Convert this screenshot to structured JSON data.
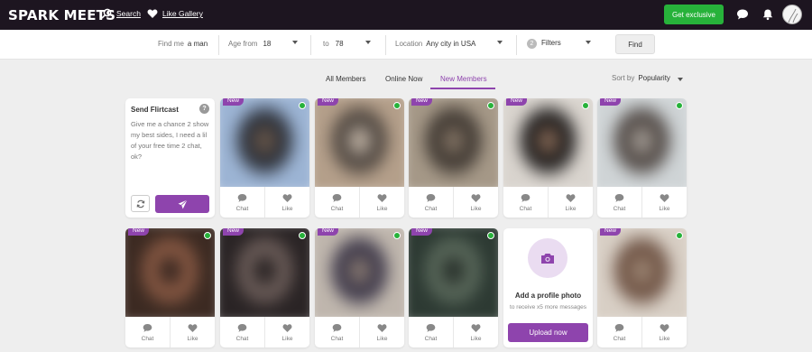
{
  "header": {
    "logo_text": "SPARK MEETS",
    "search_label": "Search",
    "like_gallery_label": "Like Gallery",
    "get_exclusive_label": "Get exclusive"
  },
  "filters": {
    "find_me_label": "Find me",
    "find_me_value": "a man",
    "age_from_label": "Age from",
    "age_from_value": "18",
    "age_to_label": "to",
    "age_to_value": "78",
    "location_label": "Location",
    "location_value": "Any city in USA",
    "filters_count": "2",
    "filters_label": "Filters",
    "find_button": "Find"
  },
  "tabs": [
    {
      "label": "All Members",
      "active": false
    },
    {
      "label": "Online Now",
      "active": false
    },
    {
      "label": "New Members",
      "active": true
    }
  ],
  "sort": {
    "label": "Sort by",
    "value": "Popularity"
  },
  "flirtcast": {
    "title": "Send Flirtcast",
    "help": "?",
    "message": "Give me a chance 2 show my best sides, I need a lil of your free time 2 chat, ok?"
  },
  "card_labels": {
    "new_badge": "New",
    "chat": "Chat",
    "like": "Like"
  },
  "members_row1": [
    {
      "new": true,
      "online": true,
      "photo_colors": [
        "#9cb4d4",
        "#2b2f38",
        "#6e5a4a"
      ]
    },
    {
      "new": true,
      "online": true,
      "photo_colors": [
        "#b49f8a",
        "#4b433d",
        "#cdbfb0"
      ]
    },
    {
      "new": true,
      "online": true,
      "photo_colors": [
        "#a59887",
        "#3d3630",
        "#8a7a6a"
      ]
    },
    {
      "new": true,
      "online": true,
      "photo_colors": [
        "#d9d4ce",
        "#1c1a1a",
        "#8e6f5b"
      ]
    },
    {
      "new": true,
      "online": true,
      "photo_colors": [
        "#cfd4d6",
        "#4e4642",
        "#aaa39c"
      ]
    }
  ],
  "members_row2": [
    {
      "new": true,
      "online": true,
      "photo_colors": [
        "#3c2a22",
        "#8a5a44",
        "#2a1e1a"
      ]
    },
    {
      "new": true,
      "online": true,
      "photo_colors": [
        "#2a2425",
        "#6e5f5b",
        "#1b1718"
      ]
    },
    {
      "new": true,
      "online": true,
      "photo_colors": [
        "#bfb6ad",
        "#3b3648",
        "#8e7f74"
      ]
    },
    {
      "new": true,
      "online": true,
      "photo_colors": [
        "#2d3a33",
        "#5b6a5c",
        "#1f2622"
      ]
    },
    {
      "new": true,
      "online": true,
      "photo_colors": [
        "#d8cfc5",
        "#6d5142",
        "#a08a78"
      ]
    }
  ],
  "upload": {
    "title": "Add a profile photo",
    "subtitle": "to receive x5 more messages",
    "button": "Upload now"
  },
  "colors": {
    "accent": "#8e44ad",
    "green": "#27b23a",
    "header_bg": "#1d1520"
  }
}
